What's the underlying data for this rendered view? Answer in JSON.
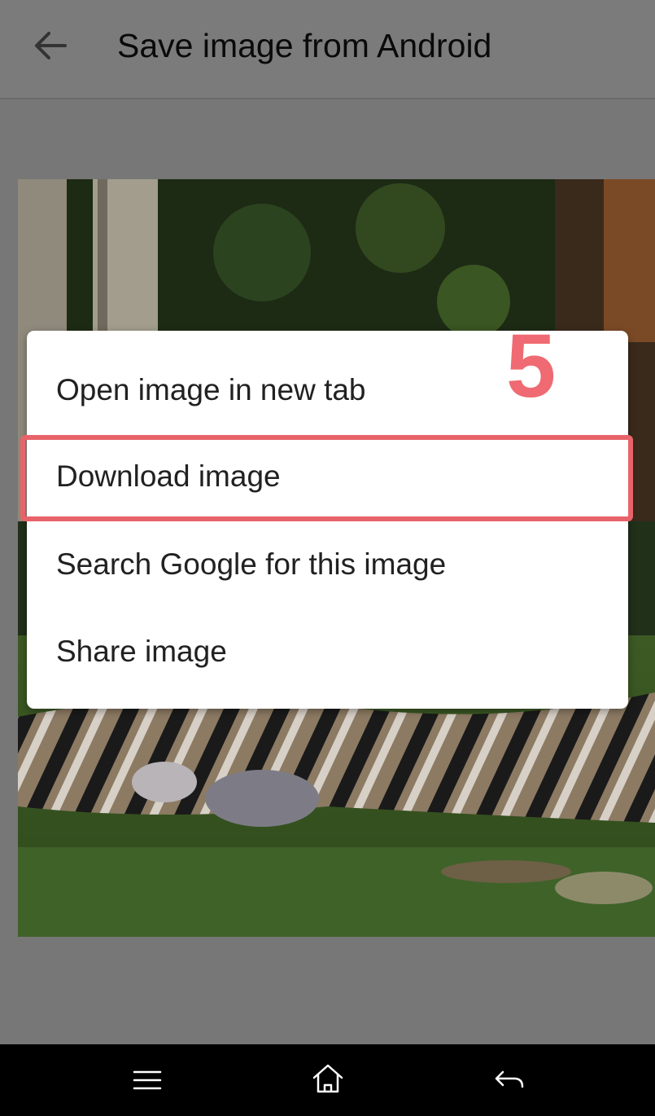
{
  "app_bar": {
    "title": "Save image from Android",
    "back_icon": "arrow-left-icon"
  },
  "context_menu": {
    "items": [
      {
        "label": "Open image in new tab"
      },
      {
        "label": "Download image"
      },
      {
        "label": "Search Google for this image"
      },
      {
        "label": "Share image"
      }
    ],
    "highlighted_item": "Download image",
    "highlight_color": "#e9636a"
  },
  "annotation": {
    "step_number": "5",
    "color": "#ef6a72"
  },
  "nav_bar": {
    "icons": [
      "menu-icon",
      "home-icon",
      "back-icon"
    ]
  }
}
